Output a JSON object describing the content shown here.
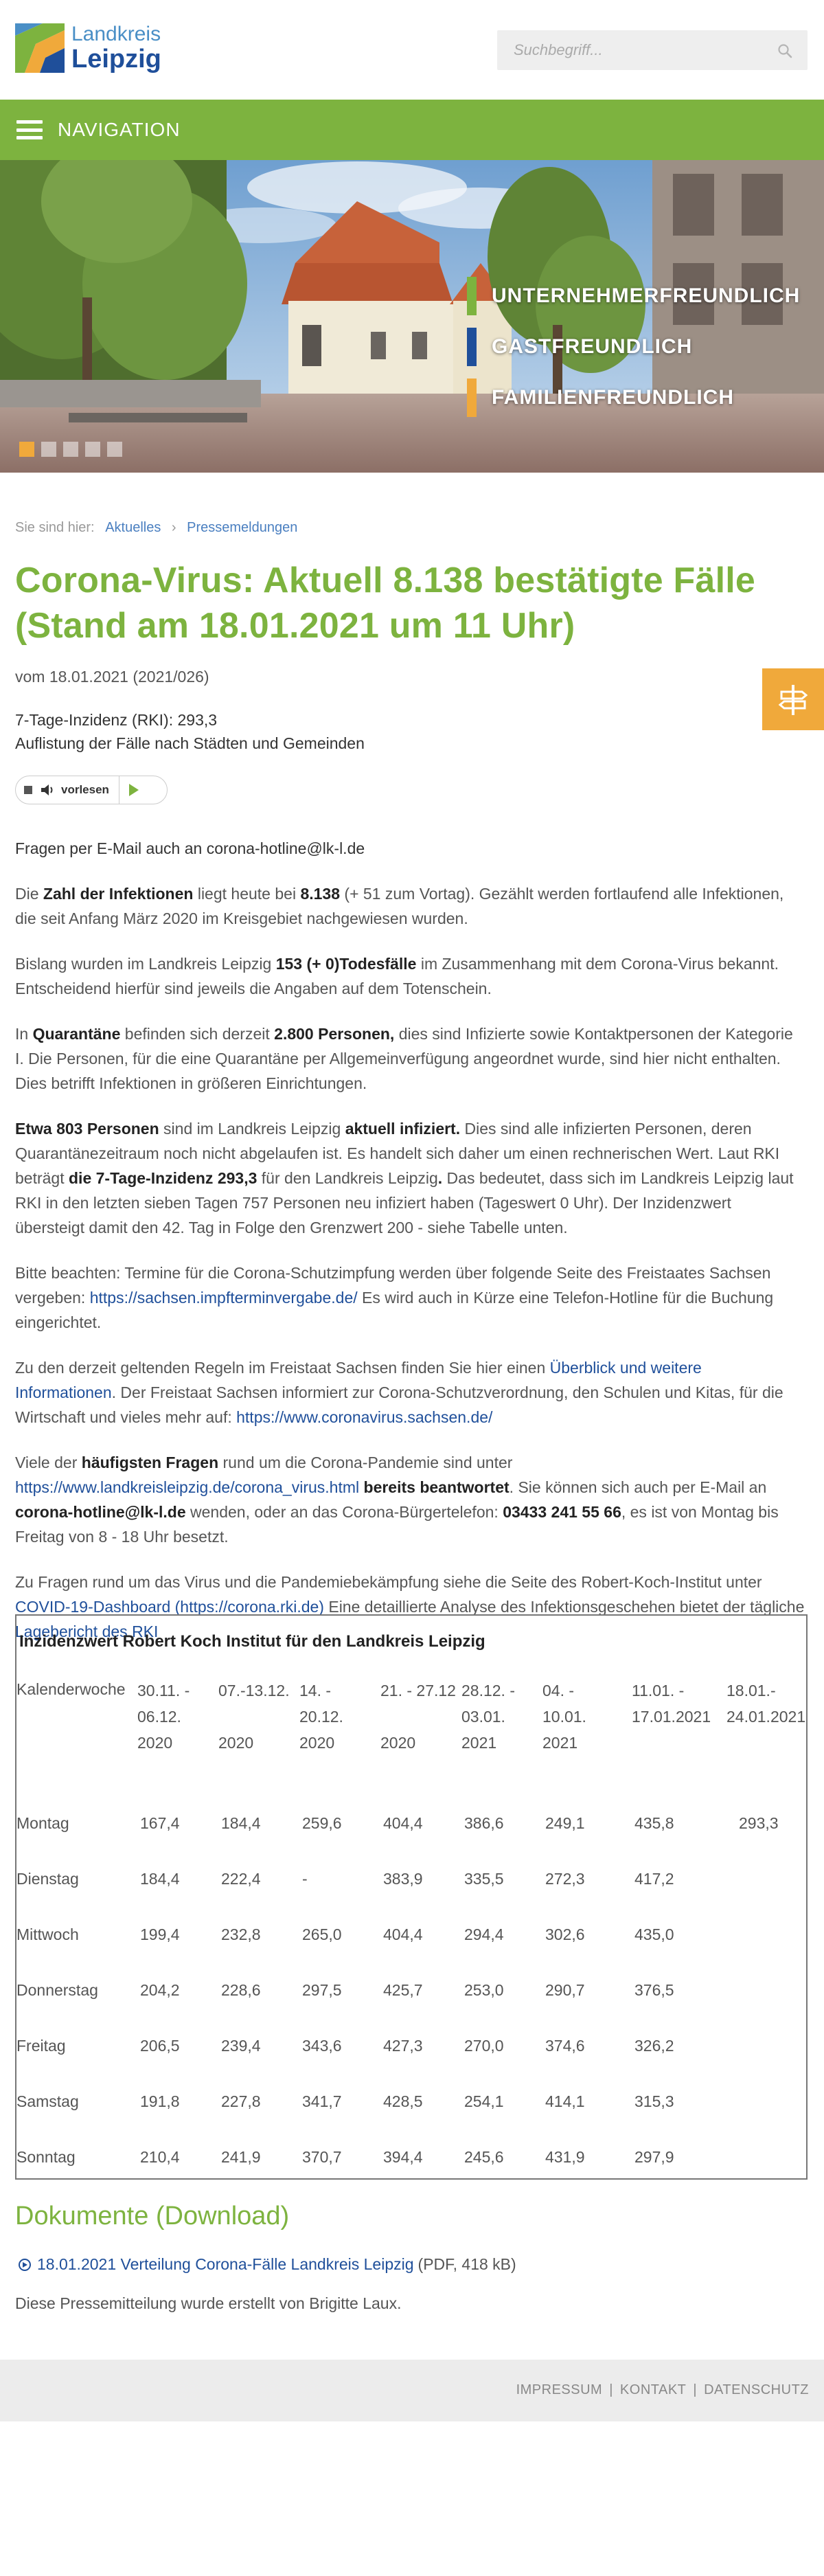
{
  "header": {
    "logo_line1": "Landkreis",
    "logo_line2": "Leipzig",
    "search_placeholder": "Suchbegriff...",
    "icon": "search-icon"
  },
  "nav": {
    "label": "NAVIGATION",
    "icon": "hamburger-icon"
  },
  "hero": {
    "claims": [
      {
        "text": "UNTERNEHMERFREUNDLICH",
        "color": "#7db33f"
      },
      {
        "text": "GASTFREUNDLICH",
        "color": "#1f4f9a"
      },
      {
        "text": "FAMILIENFREUNDLICH",
        "color": "#f0a93b"
      }
    ],
    "slides": 5
  },
  "breadcrumb": {
    "prefix": "Sie sind hier:",
    "items": [
      "Aktuelles",
      "Pressemeldungen"
    ],
    "separator": "›"
  },
  "article": {
    "title": "Corona-Virus: Aktuell 8.138 bestätigte Fälle (Stand am 18.01.2021 um 11 Uhr)",
    "dateline": "vom 18.01.2021 (2021/026)",
    "subtitle_line1": "7-Tage-Inzidenz (RKI): 293,3",
    "subtitle_line2": "Auflistung der Fälle nach Städten und Gemeinden",
    "player_label": "vorlesen",
    "questions": "Fragen per E-Mail auch an corona-hotline@lk-l.de",
    "p1": {
      "a": "Die ",
      "b1": "Zahl der Infektionen",
      "c": " liegt heute bei ",
      "b2": "8.138",
      "d": " (+ 51 zum Vortag). Gezählt werden fortlaufend alle Infektionen, die seit Anfang März 2020 im Kreisgebiet nachgewiesen wurden."
    },
    "p2": {
      "a": "Bislang wurden im Landkreis Leipzig ",
      "b1": "153 (+ 0)Todesfälle",
      "c": " im Zusammenhang mit dem Corona-Virus bekannt. Entscheidend hierfür sind jeweils die Angaben auf dem Totenschein."
    },
    "p3": {
      "a": "In ",
      "b1": "Quarantäne",
      "c": " befinden sich derzeit ",
      "b2": "2.800 Personen,",
      "d": " dies sind Infizierte sowie Kontaktpersonen der Kategorie I. Die Personen, für die eine Quarantäne per Allgemeinverfügung  angeordnet wurde, sind hier nicht enthalten. Dies betrifft Infektionen in größeren Einrichtungen."
    },
    "p4": {
      "b1": "Etwa 803 Personen",
      "a": " sind im Landkreis Leipzig ",
      "b2": "aktuell infiziert.",
      "c": " Dies sind alle infizierten Personen, deren Quarantänezeitraum noch nicht abgelaufen ist. Es handelt sich daher um einen rechnerischen Wert. Laut RKI beträgt ",
      "b3": "die 7-Tage-Inzidenz 293,3",
      "d": " für den Landkreis Leipzig",
      "b4": ".",
      "e": " Das bedeutet, dass sich im Landkreis Leipzig laut RKI in den letzten sieben Tagen 757 Personen neu infiziert haben (Tageswert 0 Uhr). Der Inzidenzwert übersteigt damit den 42. Tag in Folge den Grenzwert 200 - siehe Tabelle unten."
    },
    "p5": {
      "a": "Bitte beachten: Termine für die Corona-Schutzimpfung werden über folgende Seite des Freistaates Sachsen vergeben: ",
      "link": "https://sachsen.impfterminvergabe.de/",
      "b": "  Es wird auch in Kürze eine Telefon-Hotline für die Buchung eingerichtet."
    },
    "p6": {
      "a": "Zu den derzeit geltenden Regeln im Freistaat Sachsen finden Sie hier einen ",
      "link1": "Überblick und weitere Informationen",
      "b": ". Der Freistaat Sachsen informiert zur Corona-Schutzverordnung, den Schulen und Kitas, für die Wirtschaft und vieles mehr auf: ",
      "link2": "https://www.coronavirus.sachsen.de/"
    },
    "p7": {
      "a": "Viele der ",
      "b1": "häufigsten Fragen",
      "c": " rund um die Corona-Pandemie sind unter ",
      "link": "https://www.landkreisleipzig.de/corona_virus.html",
      "b2": " bereits beantwortet",
      "d": ". Sie können sich auch per E-Mail an ",
      "b3": "corona-hotline@lk-l.de",
      "e": " wenden, oder an das Corona-Bürgertelefon: ",
      "b4": "03433 241 55 66",
      "f": ", es ist von Montag bis Freitag von 8 - 18 Uhr besetzt."
    },
    "p8": {
      "a": "Zu Fragen rund um das Virus und die Pandemiebekämpfung siehe die Seite des Robert-Koch-Institut unter ",
      "link1": "COVID-19-Dashboard (https://corona.rki.de)",
      "b": "  Eine detaillierte Analyse des Infektionsgeschehen bietet der tägliche ",
      "link2": "Lagebericht des RKI"
    }
  },
  "table": {
    "title": "Inzidenzwert Robert Koch Institut für den Landkreis Leipzig",
    "corner": "Kalenderwoche",
    "weeks": [
      [
        "30.11. -",
        "06.12.",
        "2020"
      ],
      [
        "07.-13.12.",
        "",
        "2020"
      ],
      [
        "14. -",
        "20.12.",
        "2020"
      ],
      [
        "21. - 27.12",
        "",
        "2020"
      ],
      [
        "28.12. -",
        "03.01.",
        "2021"
      ],
      [
        "04. -",
        "10.01.",
        "2021"
      ],
      [
        "11.01. -",
        "17.01.2021",
        ""
      ],
      [
        "18.01.-",
        "24.01.2021",
        ""
      ]
    ],
    "rows": [
      {
        "day": "Montag",
        "values": [
          "167,4",
          "184,4",
          "259,6",
          "404,4",
          "386,6",
          "249,1",
          "435,8",
          "293,3"
        ]
      },
      {
        "day": "Dienstag",
        "values": [
          "184,4",
          "222,4",
          "-",
          "383,9",
          "335,5",
          "272,3",
          "417,2",
          ""
        ]
      },
      {
        "day": "Mittwoch",
        "values": [
          "199,4",
          "232,8",
          "265,0",
          "404,4",
          "294,4",
          "302,6",
          "435,0",
          ""
        ]
      },
      {
        "day": "Donnerstag",
        "values": [
          "204,2",
          "228,6",
          "297,5",
          "425,7",
          "253,0",
          "290,7",
          "376,5",
          ""
        ]
      },
      {
        "day": "Freitag",
        "values": [
          "206,5",
          "239,4",
          "343,6",
          "427,3",
          "270,0",
          "374,6",
          "326,2",
          ""
        ]
      },
      {
        "day": "Samstag",
        "values": [
          "191,8",
          "227,8",
          "341,7",
          "428,5",
          "254,1",
          "414,1",
          "315,3",
          ""
        ]
      },
      {
        "day": "Sonntag",
        "values": [
          "210,4",
          "241,9",
          "370,7",
          "394,4",
          "245,6",
          "431,9",
          "297,9",
          ""
        ]
      }
    ]
  },
  "documents": {
    "heading": "Dokumente (Download)",
    "link_text": "18.01.2021 Verteilung Corona-Fälle Landkreis Leipzig",
    "meta": "(PDF, 418 kB)",
    "author": "Diese Pressemitteilung wurde erstellt von Brigitte Laux."
  },
  "footer": {
    "links": [
      "IMPRESSUM",
      "KONTAKT",
      "DATENSCHUTZ"
    ]
  },
  "colors": {
    "green": "#7db33f",
    "blue": "#1f4f9a",
    "orange": "#f0a93b"
  }
}
